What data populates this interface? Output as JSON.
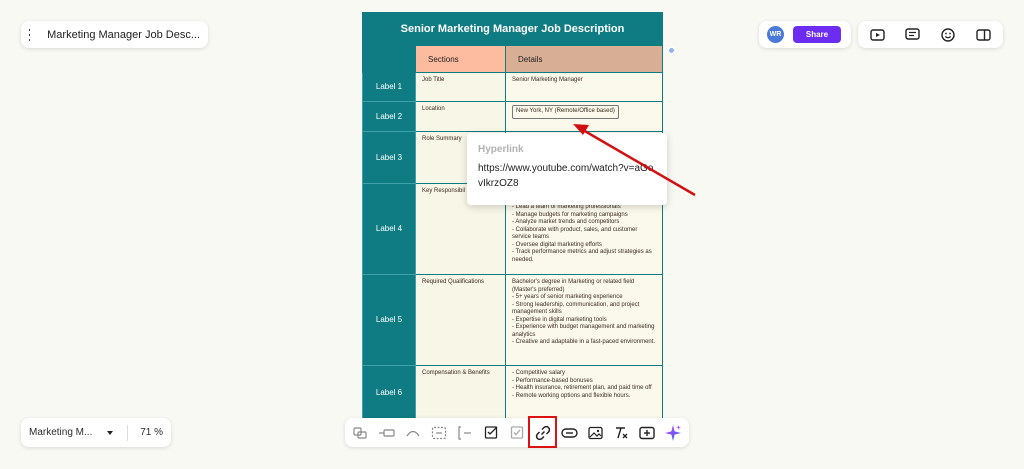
{
  "doc_panel": {
    "title": "Marketing Manager Job Desc..."
  },
  "share_panel": {
    "avatar_initials": "WR",
    "share_label": "Share"
  },
  "top_tools": [
    "present-icon",
    "comment-icon",
    "emoji-icon",
    "panel-icon"
  ],
  "zoom_panel": {
    "name": "Marketing M...",
    "zoom": "71 %"
  },
  "document": {
    "title": "Senior Marketing Manager Job Description",
    "headers": {
      "sections": "Sections",
      "details": "Details"
    },
    "rows": [
      {
        "label": "Label 1",
        "section": "Job Title",
        "details": "Senior Marketing Manager"
      },
      {
        "label": "Label 2",
        "section": "Location",
        "details": "New York, NY (Remote/Office based)"
      },
      {
        "label": "Label 3",
        "section": "Role Summary",
        "details": ""
      },
      {
        "label": "Label 4",
        "section": "Key Responsibil",
        "details": "- Lead a team of marketing professionals\n- Manage budgets for marketing campaigns\n- Analyze market trends and competitors\n- Collaborate with product, sales, and customer service teams\n- Oversee digital marketing efforts\n- Track performance metrics and adjust strategies as needed."
      },
      {
        "label": "Label 5",
        "section": "Required Qualifications",
        "details": " Bachelor's degree in Marketing or related field (Master's preferred)\n- 5+ years of senior marketing experience\n- Strong leadership, communication, and project management skills\n- Expertise in digital marketing tools\n- Experience with budget management and marketing analytics\n- Creative and adaptable in a fast-paced environment."
      },
      {
        "label": "Label 6",
        "section": "Compensation & Benefits",
        "details": "- Competitive salary\n- Performance-based bonuses\n- Health insurance, retirement plan, and paid time off\n- Remote working options and flexible hours."
      }
    ]
  },
  "popup": {
    "title": "Hyperlink",
    "url": "https://www.youtube.com/watch?v=aGovIkrzOZ8"
  },
  "bottom_tools": [
    "connector-icon",
    "line-icon",
    "curve-icon",
    "frame-icon",
    "bracket-icon",
    "note-icon",
    "checkbox-icon",
    "link-icon",
    "embed-icon",
    "image-icon",
    "clear-format-icon",
    "add-icon",
    "ai-sparkle-icon"
  ],
  "colors": {
    "teal": "#0f7c83",
    "accent": "#6c2cf2",
    "annotation": "#d11111"
  }
}
